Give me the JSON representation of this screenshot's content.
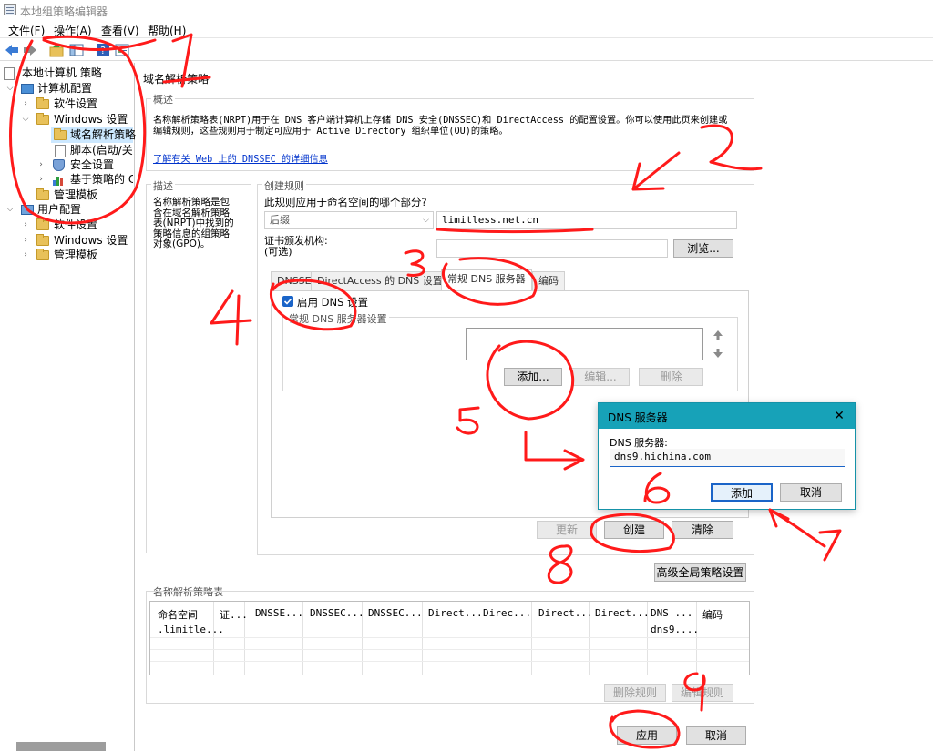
{
  "window": {
    "title": "本地组策略编辑器"
  },
  "menu": [
    "文件(F)",
    "操作(A)",
    "查看(V)",
    "帮助(H)"
  ],
  "toolbar": {
    "icons": [
      "back-arrow-icon",
      "forward-arrow-icon",
      "up-folder-icon",
      "show-hide-tree-icon",
      "help-icon",
      "properties-icon"
    ]
  },
  "tree": {
    "root": "本地计算机 策略",
    "computer_config": "计算机配置",
    "software_settings": "软件设置",
    "windows_settings": "Windows 设置",
    "nrpt": "域名解析策略",
    "scripts": "脚本(启动/关",
    "security": "安全设置",
    "policy_qos": "基于策略的 C",
    "admin_templates": "管理模板",
    "user_config": "用户配置",
    "user_software": "软件设置",
    "user_windows": "Windows 设置",
    "user_admin": "管理模板"
  },
  "pane": {
    "header": "域名解析策略",
    "overview": {
      "title": "概述",
      "text_line1": "名称解析策略表(NRPT)用于在 DNS 客户端计算机上存储 DNS 安全(DNSSEC)和 DirectAccess 的配置设置。你可以使用此页来创建或",
      "text_line2": "编辑规则，这些规则用于制定可应用于 Active Directory 组织单位(OU)的策略。",
      "link": "了解有关 Web 上的 DNSSEC 的详细信息"
    },
    "description": {
      "title": "描述",
      "text": [
        "名称解析策略是包",
        "含在域名解析策略",
        "表(NRPT)中找到的",
        "策略信息的组策略",
        "对象(GPO)。"
      ]
    },
    "create_rule": {
      "title": "创建规则",
      "question": "此规则应用于命名空间的哪个部分?",
      "suffix_select": "后缀",
      "suffix_value": "limitless.net.cn",
      "cert_label_1": "证书颁发机构:",
      "cert_label_2": "(可选)",
      "browse": "浏览...",
      "tabs": [
        "DNSSEC",
        "DirectAccess 的 DNS 设置",
        "常规 DNS 服务器",
        "编码"
      ],
      "enable_dns": "启用 DNS 设置",
      "general_dns_group": "常规 DNS 服务器设置",
      "add": "添加...",
      "edit": "编辑...",
      "delete": "删除",
      "update": "更新",
      "create": "创建",
      "clear": "清除"
    },
    "advanced": "高级全局策略设置",
    "table": {
      "title": "名称解析策略表",
      "headers": [
        "命名空间",
        "证...",
        "DNSSE...",
        "DNSSEC...",
        "DNSSEC...",
        "Direct...",
        "Direc...",
        "Direct...",
        "Direct...",
        "DNS ...",
        "编码"
      ],
      "row1_ns": ".limitle...",
      "row1_dns": "dns9...."
    },
    "delete_rule": "删除规则",
    "edit_rule": "编辑规则",
    "apply": "应用",
    "cancel": "取消"
  },
  "dialog": {
    "title": "DNS 服务器",
    "label": "DNS 服务器:",
    "value": "dns9.hichina.com",
    "add": "添加",
    "cancel": "取消"
  },
  "annotations": [
    "1",
    "2",
    "3",
    "4",
    "5",
    "6",
    "7",
    "8",
    "9"
  ],
  "colors": {
    "annotation": "#ff1a1a",
    "dialog_title": "#17a2b8",
    "link": "#0033cc",
    "selection": "#cce8ff"
  }
}
